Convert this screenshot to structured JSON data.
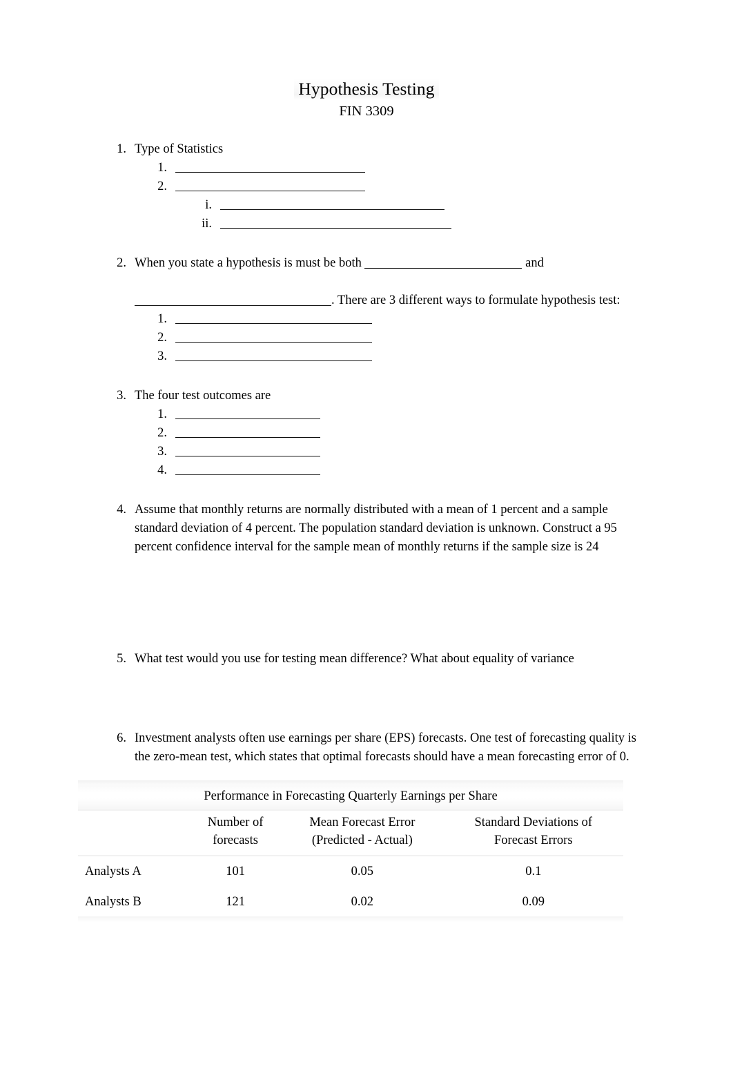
{
  "document": {
    "title": "Hypothesis Testing",
    "subtitle": "FIN 3309"
  },
  "questions": [
    {
      "number": "1.",
      "text": "Type of Statistics",
      "sub": [
        {
          "number": "1.",
          "text": ""
        },
        {
          "number": "2.",
          "text": ""
        }
      ],
      "subsub": [
        {
          "number": "i.",
          "text": ""
        },
        {
          "number": "ii.",
          "text": ""
        }
      ]
    },
    {
      "number": "2.",
      "line1_before": "When you state a hypothesis is must be both",
      "line1_after": "and",
      "line2_after": ". There are 3 different ways to formulate hypothesis test:",
      "sub": [
        {
          "number": "1.",
          "text": ""
        },
        {
          "number": "2.",
          "text": ""
        },
        {
          "number": "3.",
          "text": ""
        }
      ]
    },
    {
      "number": "3.",
      "text": "The four test outcomes are",
      "sub": [
        {
          "number": "1.",
          "text": ""
        },
        {
          "number": "2.",
          "text": ""
        },
        {
          "number": "3.",
          "text": ""
        },
        {
          "number": "4.",
          "text": ""
        }
      ]
    },
    {
      "number": "4.",
      "text": "Assume that monthly returns are normally distributed with a mean of 1 percent and a sample standard deviation of 4 percent. The population standard deviation is unknown. Construct a 95 percent confidence interval for the sample mean of monthly returns if the sample size is 24"
    },
    {
      "number": "5.",
      "text": "What test would you use for testing mean difference? What about equality of variance"
    },
    {
      "number": "6.",
      "text": "Investment analysts often use earnings per share (EPS) forecasts. One test of forecasting quality is the zero-mean test, which states that optimal forecasts should have a mean forecasting error of 0."
    }
  ],
  "table": {
    "caption": "Performance in Forecasting Quarterly Earnings per Share",
    "columns": [
      {
        "line1": "",
        "line2": ""
      },
      {
        "line1": "Number of",
        "line2": "forecasts"
      },
      {
        "line1": "Mean Forecast Error",
        "line2": "(Predicted - Actual)"
      },
      {
        "line1": "Standard Deviations of",
        "line2": "Forecast Errors"
      }
    ],
    "rows": [
      {
        "label": "Analysts A",
        "number_of_forecasts": "101",
        "mean_forecast_error": "0.05",
        "std_dev_forecast_errors": "0.1"
      },
      {
        "label": "Analysts B",
        "number_of_forecasts": "121",
        "mean_forecast_error": "0.02",
        "std_dev_forecast_errors": "0.09"
      }
    ]
  }
}
